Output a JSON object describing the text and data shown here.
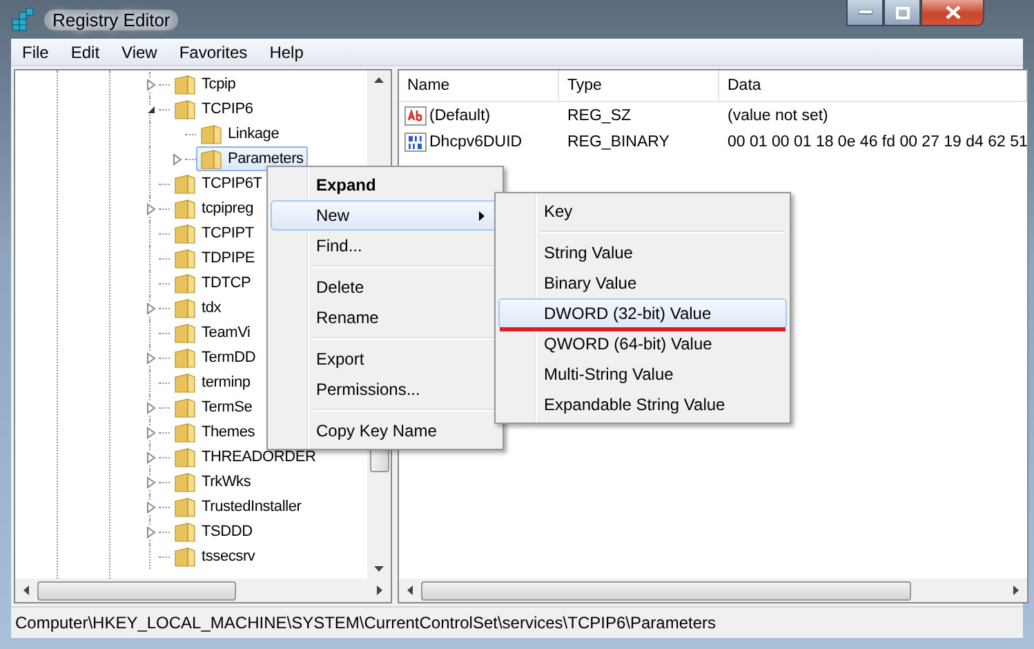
{
  "window": {
    "title": "Registry Editor"
  },
  "menu_bar": [
    "File",
    "Edit",
    "View",
    "Favorites",
    "Help"
  ],
  "tree": {
    "items": [
      {
        "label": "Tcpip",
        "kind": "collapsed",
        "selected": false
      },
      {
        "label": "TCPIP6",
        "kind": "expanded",
        "selected": false,
        "children": [
          {
            "label": "Linkage",
            "kind": "leaf",
            "selected": false
          },
          {
            "label": "Parameters",
            "kind": "collapsed",
            "selected": true
          }
        ]
      },
      {
        "label": "TCPIP6T",
        "kind": "leaf",
        "selected": false
      },
      {
        "label": "tcpipreg",
        "kind": "collapsed",
        "selected": false
      },
      {
        "label": "TCPIPT",
        "kind": "leaf",
        "selected": false
      },
      {
        "label": "TDPIPE",
        "kind": "leaf",
        "selected": false
      },
      {
        "label": "TDTCP",
        "kind": "leaf",
        "selected": false
      },
      {
        "label": "tdx",
        "kind": "collapsed",
        "selected": false
      },
      {
        "label": "TeamVi",
        "kind": "leaf",
        "selected": false
      },
      {
        "label": "TermDD",
        "kind": "collapsed",
        "selected": false
      },
      {
        "label": "terminp",
        "kind": "leaf",
        "selected": false
      },
      {
        "label": "TermSe",
        "kind": "collapsed",
        "selected": false
      },
      {
        "label": "Themes",
        "kind": "collapsed",
        "selected": false
      },
      {
        "label": "THREADORDER",
        "kind": "collapsed",
        "selected": false
      },
      {
        "label": "TrkWks",
        "kind": "collapsed",
        "selected": false
      },
      {
        "label": "TrustedInstaller",
        "kind": "collapsed",
        "selected": false
      },
      {
        "label": "TSDDD",
        "kind": "collapsed",
        "selected": false
      },
      {
        "label": "tssecsrv",
        "kind": "leaf",
        "selected": false
      }
    ]
  },
  "values_table": {
    "columns": [
      "Name",
      "Type",
      "Data"
    ],
    "rows": [
      {
        "kind": "string",
        "name": "(Default)",
        "type": "REG_SZ",
        "data": "(value not set)"
      },
      {
        "kind": "binary",
        "name": "Dhcpv6DUID",
        "type": "REG_BINARY",
        "data": "00 01 00 01 18 0e 46 fd 00 27 19 d4 62 51"
      }
    ]
  },
  "context_menu": {
    "items": [
      {
        "kind": "item",
        "label": "Expand",
        "default": true,
        "selected": false,
        "submenu": false
      },
      {
        "kind": "item",
        "label": "New",
        "default": false,
        "selected": true,
        "submenu": true
      },
      {
        "kind": "item",
        "label": "Find...",
        "default": false,
        "selected": false,
        "submenu": false
      },
      {
        "kind": "separator"
      },
      {
        "kind": "item",
        "label": "Delete",
        "default": false,
        "selected": false,
        "submenu": false
      },
      {
        "kind": "item",
        "label": "Rename",
        "default": false,
        "selected": false,
        "submenu": false
      },
      {
        "kind": "separator"
      },
      {
        "kind": "item",
        "label": "Export",
        "default": false,
        "selected": false,
        "submenu": false
      },
      {
        "kind": "item",
        "label": "Permissions...",
        "default": false,
        "selected": false,
        "submenu": false
      },
      {
        "kind": "separator"
      },
      {
        "kind": "item",
        "label": "Copy Key Name",
        "default": false,
        "selected": false,
        "submenu": false
      }
    ]
  },
  "submenu": {
    "items": [
      {
        "kind": "item",
        "label": "Key",
        "selected": false,
        "underlined": false
      },
      {
        "kind": "separator"
      },
      {
        "kind": "item",
        "label": "String Value",
        "selected": false,
        "underlined": false
      },
      {
        "kind": "item",
        "label": "Binary Value",
        "selected": false,
        "underlined": false
      },
      {
        "kind": "item",
        "label": "DWORD (32-bit) Value",
        "selected": true,
        "underlined": true
      },
      {
        "kind": "item",
        "label": "QWORD (64-bit) Value",
        "selected": false,
        "underlined": false
      },
      {
        "kind": "item",
        "label": "Multi-String Value",
        "selected": false,
        "underlined": false
      },
      {
        "kind": "item",
        "label": "Expandable String Value",
        "selected": false,
        "underlined": false
      }
    ]
  },
  "status_bar": "Computer\\HKEY_LOCAL_MACHINE\\SYSTEM\\CurrentControlSet\\services\\TCPIP6\\Parameters"
}
